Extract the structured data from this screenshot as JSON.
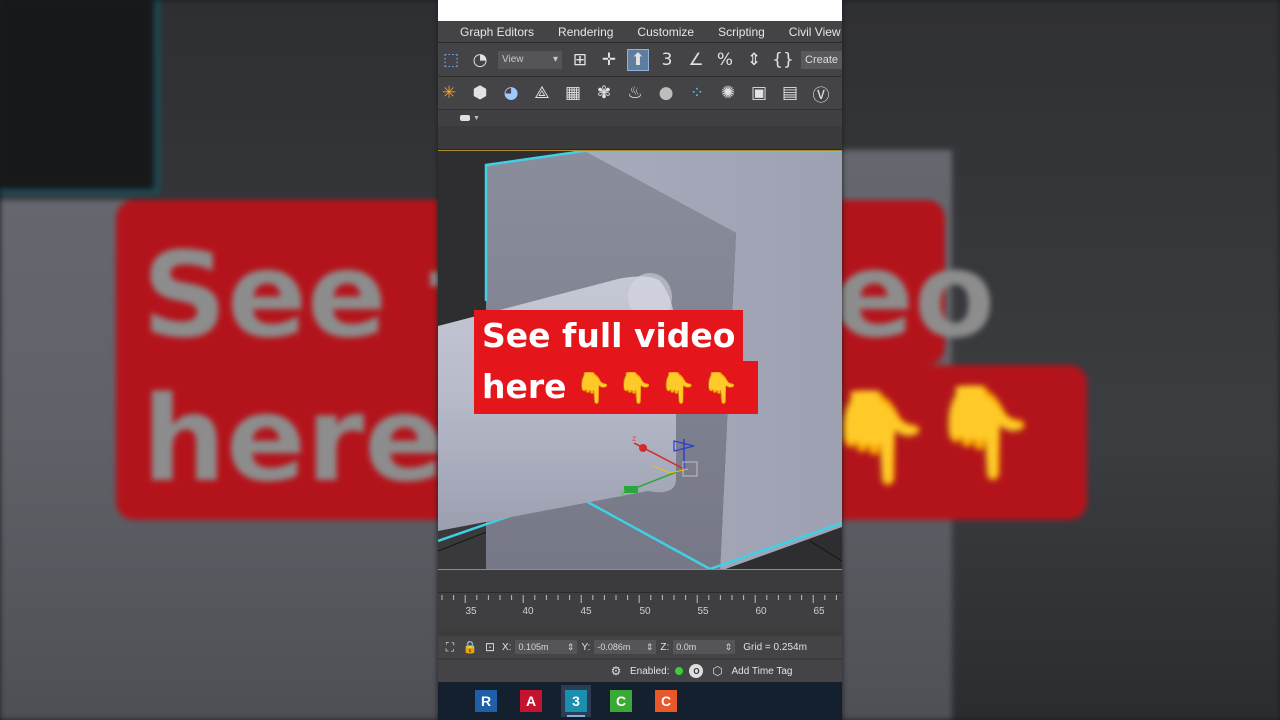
{
  "menu": {
    "items": [
      "Graph Editors",
      "Rendering",
      "Customize",
      "Scripting",
      "Civil View"
    ]
  },
  "toolbar": {
    "view_dropdown": "View",
    "create_button": "Create"
  },
  "timeline": {
    "ruler_numbers": [
      "35",
      "40",
      "45",
      "50",
      "55",
      "60",
      "65"
    ]
  },
  "status": {
    "x_label": "X:",
    "x_value": "0.105m",
    "y_label": "Y:",
    "y_value": "-0.086m",
    "z_label": "Z:",
    "z_value": "0.0m",
    "grid": "Grid = 0.254m",
    "enabled_label": "Enabled:",
    "add_time_tag": "Add Time Tag"
  },
  "overlay": {
    "line1": "See full video",
    "line2": "here",
    "hands": "👇👇👇👇",
    "bg_line1_left": "See f",
    "bg_line2_left": "here",
    "bg_line1_right": "eo"
  },
  "taskbar": {
    "apps": [
      {
        "name": "revit",
        "letter": "R",
        "color": "#1f5fa8"
      },
      {
        "name": "autocad",
        "letter": "A",
        "color": "#c4122f"
      },
      {
        "name": "3ds-max",
        "letter": "3",
        "color": "#1a8fb0"
      },
      {
        "name": "camtasia-green",
        "letter": "C",
        "color": "#3aa935"
      },
      {
        "name": "camtasia-orange",
        "letter": "C",
        "color": "#e9582a"
      }
    ]
  },
  "colors": {
    "selection_outline": "#3fd0e6",
    "promo_red": "#e4151b",
    "viewport_border": "#b08a2e"
  }
}
